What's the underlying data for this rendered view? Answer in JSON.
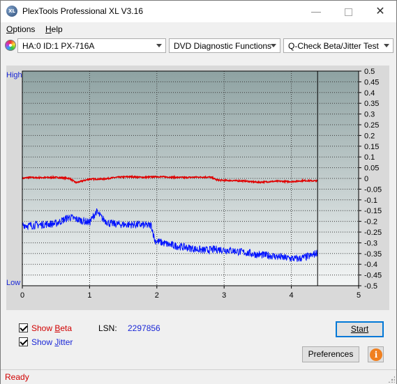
{
  "window": {
    "title": "PlexTools Professional XL V3.16",
    "logo_text": "XL",
    "controls": [
      "minimize-icon",
      "maximize-icon",
      "close-icon"
    ]
  },
  "menu": {
    "items": [
      {
        "label": "Options",
        "accel": "O"
      },
      {
        "label": "Help",
        "accel": "H"
      }
    ]
  },
  "toolbar": {
    "drive": "HA:0 ID:1  PX-716A",
    "function": "DVD Diagnostic Functions",
    "test": "Q-Check Beta/Jitter Test"
  },
  "chart": {
    "high_label": "High",
    "low_label": "Low"
  },
  "chart_data": {
    "type": "line",
    "xlim": [
      0,
      5
    ],
    "ylim": [
      -0.5,
      0.5
    ],
    "x_ticks": [
      "0",
      "1",
      "2",
      "3",
      "4",
      "5"
    ],
    "y_ticks": [
      "0.5",
      "0.45",
      "0.4",
      "0.35",
      "0.3",
      "0.25",
      "0.2",
      "0.15",
      "0.1",
      "0.05",
      "0",
      "-0.05",
      "-0.1",
      "-0.15",
      "-0.2",
      "-0.25",
      "-0.3",
      "-0.35",
      "-0.4",
      "-0.45",
      "-0.5"
    ],
    "marker_x": 4.39,
    "grid": true,
    "series": [
      {
        "name": "Beta",
        "color": "#e00000",
        "noise": 0.003,
        "x": [
          0,
          0.1,
          0.2,
          0.5,
          0.7,
          0.8,
          1.0,
          1.2,
          1.4,
          1.6,
          1.8,
          2.0,
          2.2,
          2.4,
          2.6,
          2.8,
          2.9,
          3.1,
          3.3,
          3.5,
          3.8,
          4.0,
          4.2,
          4.39
        ],
        "y": [
          0,
          0.005,
          0.003,
          0.005,
          0.0,
          -0.02,
          -0.003,
          -0.003,
          0.005,
          0.008,
          0.005,
          0.008,
          0.006,
          0.004,
          0.006,
          0.006,
          -0.008,
          -0.01,
          -0.012,
          -0.018,
          -0.013,
          -0.015,
          -0.01,
          -0.012
        ]
      },
      {
        "name": "Jitter",
        "color": "#0012ff",
        "noise": 0.018,
        "x": [
          0,
          0.1,
          0.3,
          0.5,
          0.7,
          0.8,
          1.0,
          1.1,
          1.2,
          1.3,
          1.5,
          1.7,
          1.92,
          1.97,
          2.2,
          2.5,
          2.7,
          2.9,
          3.1,
          3.3,
          3.5,
          3.7,
          3.9,
          4.1,
          4.3,
          4.39
        ],
        "y": [
          -0.215,
          -0.22,
          -0.215,
          -0.21,
          -0.18,
          -0.19,
          -0.205,
          -0.155,
          -0.19,
          -0.21,
          -0.215,
          -0.215,
          -0.22,
          -0.29,
          -0.31,
          -0.325,
          -0.335,
          -0.33,
          -0.335,
          -0.345,
          -0.355,
          -0.36,
          -0.37,
          -0.375,
          -0.36,
          -0.345
        ]
      }
    ]
  },
  "options": {
    "show_beta": {
      "label": "Show Beta",
      "accel": "B",
      "checked": true,
      "color": "#d00000"
    },
    "show_jitter": {
      "label": "Show Jitter",
      "accel": "J",
      "checked": true,
      "color": "#1a27d6"
    }
  },
  "lsn": {
    "label": "LSN:",
    "value": "2297856",
    "value_color": "#1a27d6"
  },
  "buttons": {
    "start": "Start",
    "preferences": "Preferences",
    "info_icon": "info-icon"
  },
  "status": {
    "text": "Ready"
  }
}
